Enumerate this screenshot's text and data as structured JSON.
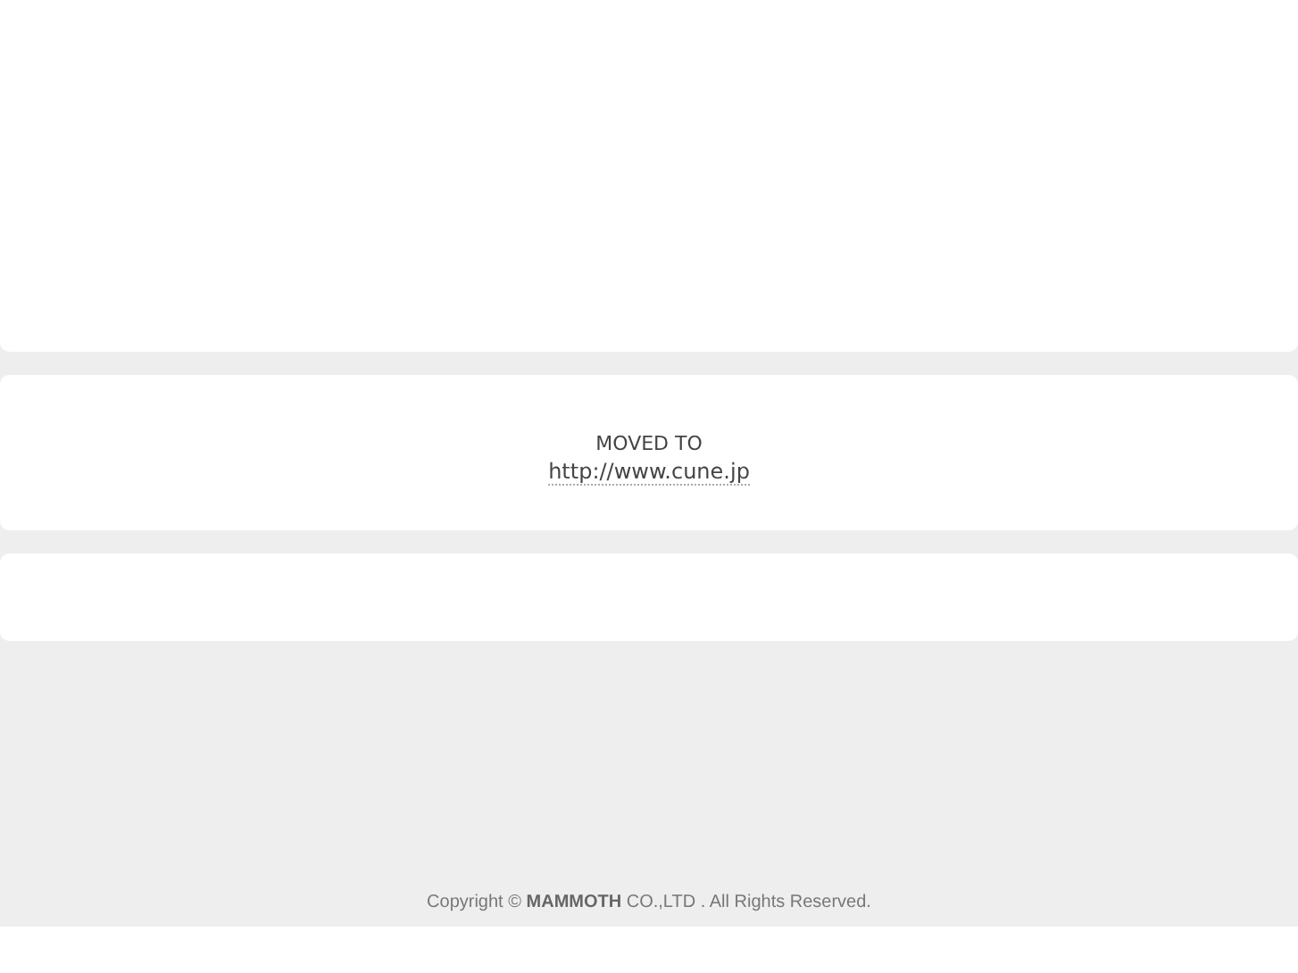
{
  "notice": {
    "heading": "MOVED TO",
    "link": "http://www.cune.jp"
  },
  "footer": {
    "copyright": "Copyright © **MAMMOTH** CO.,LTD . All Rights Reserved."
  }
}
